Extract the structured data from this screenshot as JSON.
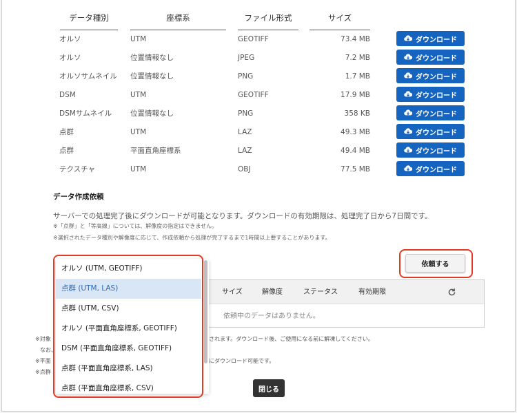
{
  "table": {
    "headers": [
      "データ種別",
      "座標系",
      "ファイル形式",
      "サイズ"
    ],
    "rows": [
      {
        "type": "オルソ",
        "crs": "UTM",
        "format": "GEOTIFF",
        "size": "73.4 MB"
      },
      {
        "type": "オルソ",
        "crs": "位置情報なし",
        "format": "JPEG",
        "size": "7.2 MB"
      },
      {
        "type": "オルソサムネイル",
        "crs": "位置情報なし",
        "format": "PNG",
        "size": "1.7 MB"
      },
      {
        "type": "DSM",
        "crs": "UTM",
        "format": "GEOTIFF",
        "size": "17.9 MB"
      },
      {
        "type": "DSMサムネイル",
        "crs": "位置情報なし",
        "format": "PNG",
        "size": "358 KB"
      },
      {
        "type": "点群",
        "crs": "UTM",
        "format": "LAZ",
        "size": "49.3 MB"
      },
      {
        "type": "点群",
        "crs": "平面直角座標系",
        "format": "LAZ",
        "size": "49.4 MB"
      },
      {
        "type": "テクスチャ",
        "crs": "UTM",
        "format": "OBJ",
        "size": "77.5 MB"
      }
    ],
    "download_label": "ダウンロード"
  },
  "request": {
    "title": "データ作成依頼",
    "description": "サーバーでの処理完了後にダウンロードが可能となります。ダウンロードの有効期限は、処理完了日から7日間です。",
    "note1": "※「点群」と「等高線」については、解像度の指定はできません。",
    "note2": "※選択されたデータ種別や解像度に応じて、作成依頼から処理が完了するまで1時間以上要することがあります。",
    "button_label": "依頼する"
  },
  "status_table": {
    "headers": [
      "サイズ",
      "解像度",
      "ステータス",
      "有効期限"
    ],
    "empty_text": "依頼中のデータはありません。"
  },
  "bottom_notes": {
    "n1_left": "※対象",
    "n1_right": "されます。ダウンロード後、ご使用になる前に解凍してください。",
    "n2_left": "なお、",
    "n3_left": "※平面",
    "n3_right": "にダウンロード可能です。",
    "n4_left": "※点群"
  },
  "close_label": "閉じる",
  "dropdown": {
    "options": [
      "オルソ (UTM, GEOTIFF)",
      "点群 (UTM, LAS)",
      "点群 (UTM, CSV)",
      "オルソ (平面直角座標系, GEOTIFF)",
      "DSM (平面直角座標系, GEOTIFF)",
      "点群 (平面直角座標系, LAS)",
      "点群 (平面直角座標系, CSV)"
    ],
    "selected": "点群 (UTM, LAS)"
  },
  "colors": {
    "primary": "#1565c0",
    "highlight": "#e53923",
    "selected_bg": "#d9e6f6"
  }
}
